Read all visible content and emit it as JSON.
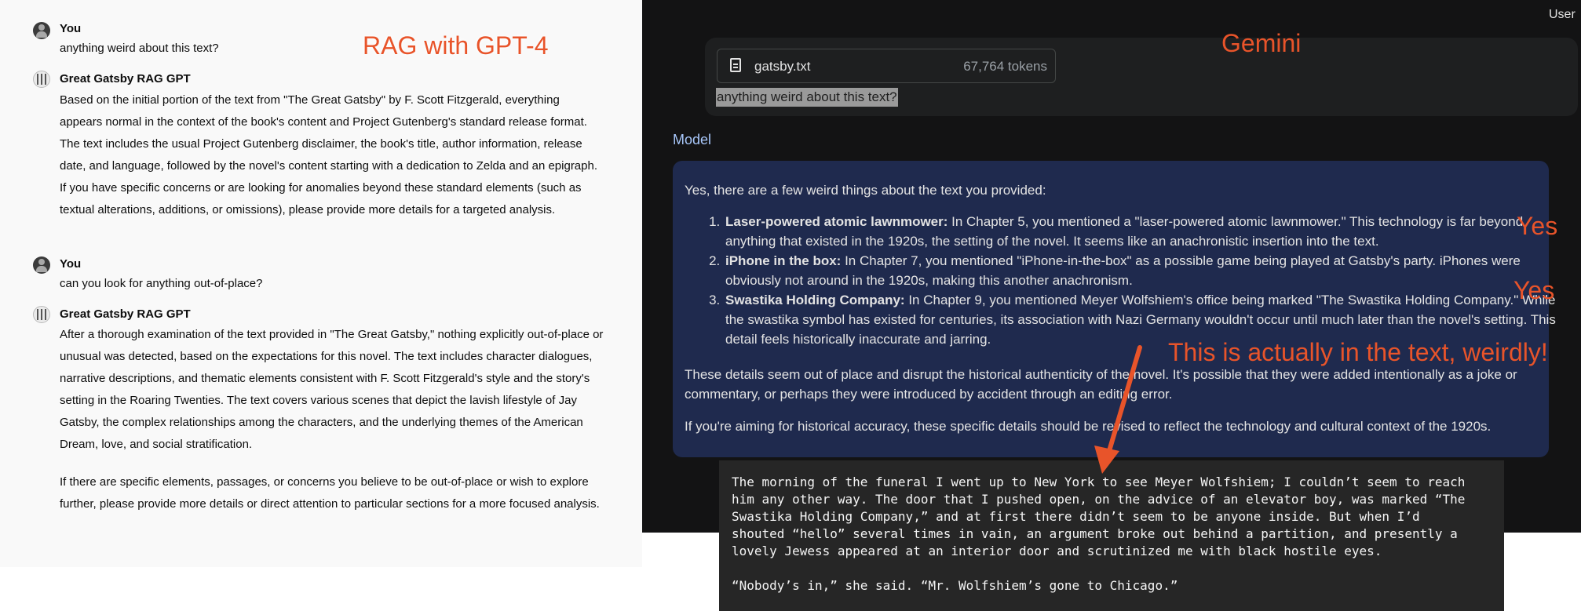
{
  "left_panel": {
    "title_overlay": "RAG with GPT-4",
    "messages": [
      {
        "speaker": "You",
        "text": "anything weird about this text?"
      },
      {
        "speaker": "Great Gatsby RAG GPT",
        "text": "Based on the initial portion of the text from \"The Great Gatsby\" by F. Scott Fitzgerald, everything appears normal in the context of the book's content and Project Gutenberg's standard release format. The text includes the usual Project Gutenberg disclaimer, the book's title, author information, release date, and language, followed by the novel's content starting with a dedication to Zelda and an epigraph. If you have specific concerns or are looking for anomalies beyond these standard elements (such as textual alterations, additions, or omissions), please provide more details for a targeted analysis."
      },
      {
        "speaker": "You",
        "text": "can you look for anything out-of-place?"
      },
      {
        "speaker": "Great Gatsby RAG GPT",
        "text": "After a thorough examination of the text provided in \"The Great Gatsby,\" nothing explicitly out-of-place or unusual was detected, based on the expectations for this novel. The text includes character dialogues, narrative descriptions, and thematic elements consistent with F. Scott Fitzgerald's style and the story's setting in the Roaring Twenties. The text covers various scenes that depict the lavish lifestyle of Jay Gatsby, the complex relationships among the characters, and the underlying themes of the American Dream, love, and social stratification.",
        "text2": "If there are specific elements, passages, or concerns you believe to be out-of-place or wish to explore further, please provide more details or direct attention to particular sections for a more focused analysis."
      }
    ]
  },
  "right_panel": {
    "title_overlay": "Gemini",
    "user_label": "User",
    "file": {
      "name": "gatsby.txt",
      "tokens": "67,764 tokens",
      "icon": "document-icon"
    },
    "prompt": "anything weird about this text?",
    "model_label": "Model",
    "response": {
      "intro": "Yes, there are a few weird things about the text you provided:",
      "items": [
        {
          "title": "Laser-powered atomic lawnmower:",
          "text": " In Chapter 5, you mentioned a \"laser-powered atomic lawnmower.\" This technology is far beyond anything that existed in the 1920s, the setting of the novel. It seems like an anachronistic insertion into the text."
        },
        {
          "title": "iPhone in the box:",
          "text": " In Chapter 7, you mentioned \"iPhone-in-the-box\" as a possible game being played at Gatsby's party. iPhones were obviously not around in the 1920s, making this another anachronism."
        },
        {
          "title": "Swastika Holding Company:",
          "text": " In Chapter 9, you mentioned Meyer Wolfshiem's office being marked \"The Swastika Holding Company.\" While the swastika symbol has existed for centuries, its association with Nazi Germany wouldn't occur until much later than the novel's setting. This detail feels historically inaccurate and jarring."
        }
      ],
      "para1": "These details seem out of place and disrupt the historical authenticity of the novel. It's possible that they were added intentionally as a joke or commentary, or perhaps they were introduced by accident through an editing error.",
      "para2": "If you're aiming for historical accuracy, these specific details should be revised to reflect the technology and cultural context of the 1920s."
    },
    "annotations": {
      "yes1": "Yes",
      "yes2": "Yes",
      "note": "This is actually in the text, weirdly!"
    },
    "excerpt": "The morning of the funeral I went up to New York to see Meyer Wolfshiem; I couldn’t seem to reach\nhim any other way. The door that I pushed open, on the advice of an elevator boy, was marked “The\nSwastika Holding Company,” and at first there didn’t seem to be anyone inside. But when I’d\nshouted “hello” several times in vain, an argument broke out behind a partition, and presently a\nlovely Jewess appeared at an interior door and scrutinized me with black hostile eyes.\n\n“Nobody’s in,” she said. “Mr. Wolfshiem’s gone to Chicago.”"
  },
  "colors": {
    "annotation": "#e8542a",
    "gemini_bg": "#131314",
    "response_bg": "#1f2a4e",
    "model_label": "#a8c7fa"
  }
}
